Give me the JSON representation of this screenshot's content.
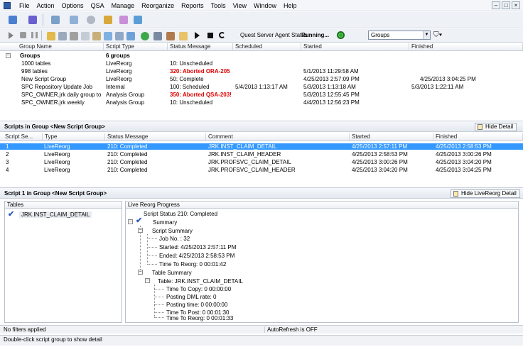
{
  "menu": [
    "File",
    "Action",
    "Options",
    "QSA",
    "Manage",
    "Reorganize",
    "Reports",
    "Tools",
    "View",
    "Window",
    "Help"
  ],
  "window_controls": [
    "–",
    "□",
    "×"
  ],
  "agent": {
    "label": "Quest Server Agent Status:",
    "status": "Running..."
  },
  "groups_select": "Groups",
  "groups_grid": {
    "columns": [
      "Group Name",
      "Script Type",
      "Status Message",
      "Scheduled",
      "Started",
      "Finished"
    ],
    "group_header": {
      "name": "Groups",
      "type": "6 groups"
    },
    "rows": [
      {
        "name": "1000 tables",
        "type": "LiveReorg",
        "status": "10: Unscheduled",
        "scheduled": "",
        "started": "",
        "finished": "",
        "error": false
      },
      {
        "name": "998 tables",
        "type": "LiveReorg",
        "status": "320: Aborted ORA-205",
        "scheduled": "",
        "started": "5/1/2013 11:29:58 AM",
        "finished": "",
        "error": true
      },
      {
        "name": "New Script Group",
        "type": "LiveReorg",
        "status": "50: Complete",
        "scheduled": "",
        "started": "4/25/2013 2:57:09 PM",
        "finished": "4/25/2013 3:04:25 PM",
        "error": false
      },
      {
        "name": "SPC Repository Update Job",
        "type": "Internal",
        "status": "100: Scheduled",
        "scheduled": "5/4/2013 1:13:17 AM",
        "started": "5/3/2013 1:13:18 AM",
        "finished": "5/3/2013 1:22:11 AM",
        "error": false
      },
      {
        "name": "SPC_OWNER.jrk daily group to t",
        "type": "Analysis Group",
        "status": "350: Aborted QSA-203!",
        "scheduled": "",
        "started": "5/3/2013 12:55:45 PM",
        "finished": "",
        "error": true
      },
      {
        "name": "SPC_OWNER.jrk weekly",
        "type": "Analysis Group",
        "status": "10: Unscheduled",
        "scheduled": "",
        "started": "4/4/2013 12:56:23 PM",
        "finished": "",
        "error": false
      }
    ]
  },
  "scripts_panel": {
    "title": "Scripts in Group <New Script Group>",
    "hide_label": "Hide Detail",
    "columns": [
      "Script Se...",
      "Type",
      "Status Message",
      "Comment",
      "Started",
      "Finished"
    ],
    "rows": [
      {
        "seq": "1",
        "type": "LiveReorg",
        "status": "210: Completed",
        "comment": "JRK.INST_CLAIM_DETAIL",
        "started": "4/25/2013 2:57:11 PM",
        "finished": "4/25/2013 2:58:53 PM"
      },
      {
        "seq": "2",
        "type": "LiveReorg",
        "status": "210: Completed",
        "comment": "JRK.INST_CLAIM_HEADER",
        "started": "4/25/2013 2:58:53 PM",
        "finished": "4/25/2013 3:00:26 PM"
      },
      {
        "seq": "3",
        "type": "LiveReorg",
        "status": "210: Completed",
        "comment": "JRK.PROFSVC_CLAIM_DETAIL",
        "started": "4/25/2013 3:00:26 PM",
        "finished": "4/25/2013 3:04:20 PM"
      },
      {
        "seq": "4",
        "type": "LiveReorg",
        "status": "210: Completed",
        "comment": "JRK.PROFSVC_CLAIM_HEADER",
        "started": "4/25/2013 3:04:20 PM",
        "finished": "4/25/2013 3:04:25 PM"
      }
    ]
  },
  "script_detail": {
    "title": "Script 1 in Group <New Script Group>",
    "hide_label": "Hide LiveReorg Detail",
    "tables_header": "Tables",
    "table_item": "JRK.INST_CLAIM_DETAIL",
    "progress_header": "Live Reorg Progress",
    "tree": {
      "status": "Script Status 210: Completed",
      "summary": "Summary",
      "script_summary": "Script Summary",
      "job_no": "Job No. : 32",
      "started": "Started: 4/25/2013 2:57:11 PM",
      "ended": "Ended: 4/25/2013 2:58:53 PM",
      "time_to_reorg": "Time To Reorg: 0 00:01:42",
      "table_summary": "Table Summary",
      "table": "Table: JRK.INST_CLAIM_DETAIL",
      "time_to_copy": "Time To Copy: 0 00:00:00",
      "posting_dml_rate": "Posting DML rate: 0",
      "posting_time": "Posting time: 0 00:00:00",
      "time_to_post": "Time To Post: 0 00:01:30",
      "time_to_reorg_table": "Time To Reorg: 0 00:01:33"
    }
  },
  "status": {
    "filters": "No filters applied",
    "autorefresh": "AutoRefresh is OFF",
    "hint": "Double-click script group to show detail"
  },
  "colors": {
    "selection": "#3399ff",
    "error": "#e00000",
    "agent_ok": "#2fa82f"
  }
}
